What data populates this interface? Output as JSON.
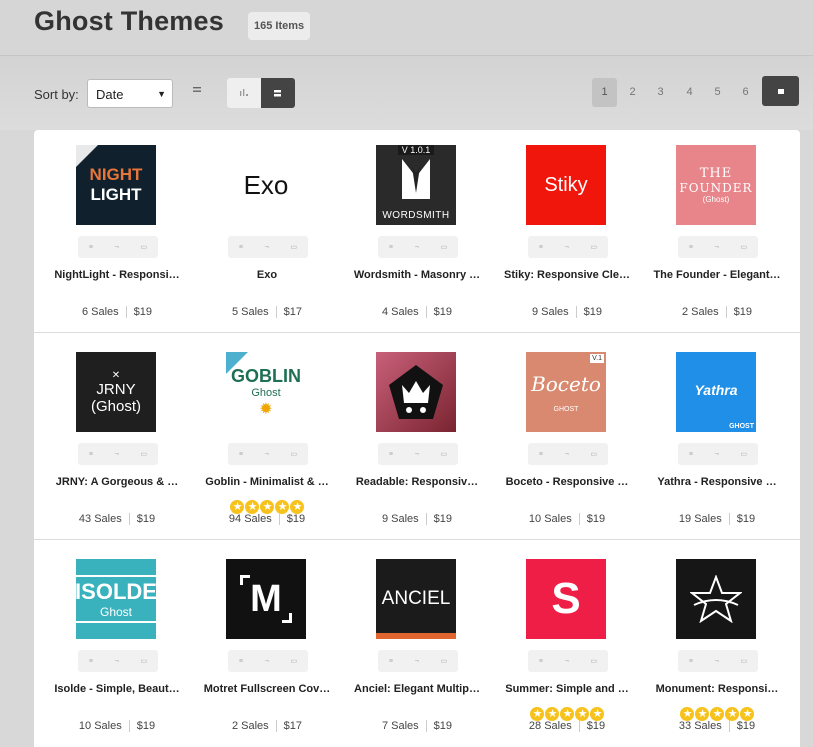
{
  "header": {
    "title": "Ghost Themes",
    "count": "165 Items"
  },
  "sort": {
    "label": "Sort by:",
    "value": "Date",
    "caret": "▼"
  },
  "pagination": {
    "pages": [
      "1",
      "2",
      "3",
      "4",
      "5",
      "6"
    ],
    "active": "1"
  },
  "colors": {
    "page_bg": "#d8d8d8",
    "dark_button": "#444444",
    "star": "#f7c21c"
  },
  "items": [
    {
      "name": "NightLight - Responsi…",
      "sales": "6 Sales",
      "price": "$19",
      "thumb": {
        "bg": "#10202c",
        "lines": [
          "NIGHT",
          "LIGHT"
        ],
        "color": "#e8763a",
        "color2": "#ffffff"
      }
    },
    {
      "name": "Exo",
      "sales": "5 Sales",
      "price": "$17",
      "thumb": {
        "bg": "#ffffff",
        "lines": [
          "Exo"
        ],
        "color": "#111111"
      }
    },
    {
      "name": "Wordsmith - Masonry …",
      "sales": "4 Sales",
      "price": "$19",
      "thumb": {
        "bg": "#2a2a2a",
        "lines": [
          "V 1.0.1",
          "WORDSMITH"
        ],
        "color": "#ffffff"
      }
    },
    {
      "name": "Stiky: Responsive Cle…",
      "sales": "9 Sales",
      "price": "$19",
      "thumb": {
        "bg": "#f0160b",
        "lines": [
          "Stiky"
        ],
        "color": "#ffffff"
      }
    },
    {
      "name": "The Founder - Elegant…",
      "sales": "2 Sales",
      "price": "$19",
      "thumb": {
        "bg": "#e8858a",
        "lines": [
          "THE",
          "FOUNDER",
          "(Ghost)"
        ],
        "color": "#ffffff"
      }
    },
    {
      "name": "JRNY: A Gorgeous & …",
      "sales": "43 Sales",
      "price": "$19",
      "thumb": {
        "bg": "#1f1f1f",
        "lines": [
          "JRNY",
          "(Ghost)"
        ],
        "color": "#ffffff"
      }
    },
    {
      "name": "Goblin - Minimalist & …",
      "sales": "94 Sales",
      "price": "$19",
      "stars": 5,
      "thumb": {
        "bg": "#ffffff",
        "lines": [
          "GOBLIN",
          "Ghost"
        ],
        "color": "#1f6f55"
      }
    },
    {
      "name": "Readable: Responsiv…",
      "sales": "9 Sales",
      "price": "$19",
      "thumb": {
        "bg": "#b0484a",
        "lines": [],
        "color": "#ffffff"
      }
    },
    {
      "name": "Boceto - Responsive …",
      "sales": "10 Sales",
      "price": "$19",
      "thumb": {
        "bg": "#d9896f",
        "lines": [
          "Boceto",
          "GHOST"
        ],
        "color": "#ffffff"
      }
    },
    {
      "name": "Yathra - Responsive …",
      "sales": "19 Sales",
      "price": "$19",
      "thumb": {
        "bg": "#1f8fe8",
        "lines": [
          "Yathra",
          "GHOST"
        ],
        "color": "#ffffff"
      }
    },
    {
      "name": "Isolde - Simple, Beaut…",
      "sales": "10 Sales",
      "price": "$19",
      "thumb": {
        "bg": "#3ab2be",
        "lines": [
          "ISOLDE",
          "Ghost"
        ],
        "color": "#ffffff"
      }
    },
    {
      "name": "Motret Fullscreen Cov…",
      "sales": "2 Sales",
      "price": "$17",
      "thumb": {
        "bg": "#111111",
        "lines": [
          "M"
        ],
        "color": "#ffffff"
      }
    },
    {
      "name": "Anciel: Elegant Multip…",
      "sales": "7 Sales",
      "price": "$19",
      "thumb": {
        "bg": "#1b1b1b",
        "lines": [
          "ANCIEL"
        ],
        "color": "#ffffff"
      }
    },
    {
      "name": "Summer: Simple and …",
      "sales": "28 Sales",
      "price": "$19",
      "stars": 5,
      "thumb": {
        "bg": "#ef1e46",
        "lines": [
          "S"
        ],
        "color": "#ffffff"
      }
    },
    {
      "name": "Monument: Responsi…",
      "sales": "33 Sales",
      "price": "$19",
      "stars": 5,
      "thumb": {
        "bg": "#161616",
        "lines": [],
        "color": "#ffffff"
      }
    }
  ]
}
